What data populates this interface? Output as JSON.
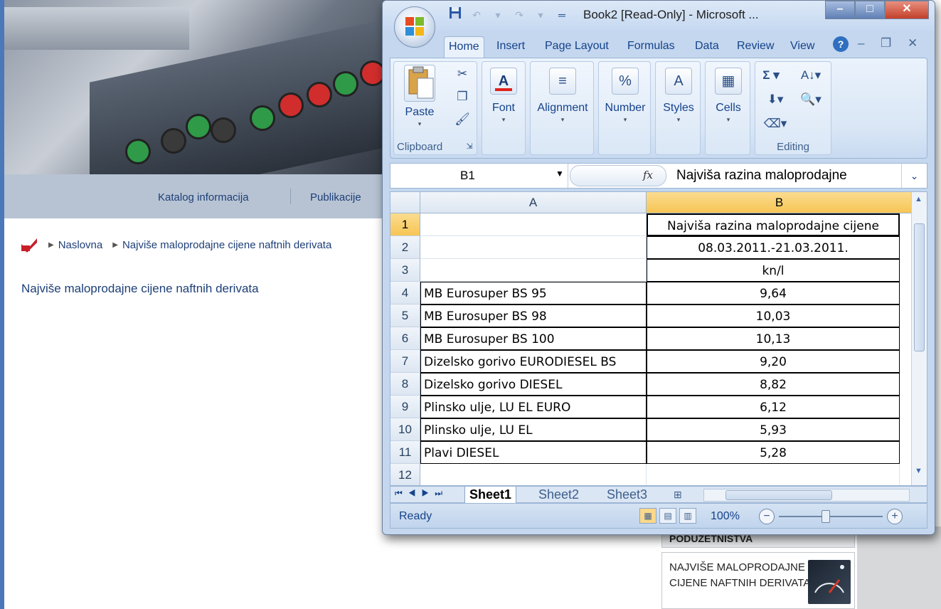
{
  "web": {
    "nav": [
      "Katalog informacija",
      "Publikacije"
    ],
    "breadcrumb": [
      "Naslovna",
      "Najviše maloprodajne cijene naftnih derivata"
    ],
    "heading": "Najviše maloprodajne cijene naftnih derivata",
    "side_box_1": "PODUZETNIŠTVA",
    "side_box_2": "NAJVIŠE MALOPRODAJNE CIJENE NAFTNIH DERIVATA"
  },
  "excel": {
    "title": "Book2  [Read-Only] - Microsoft ...",
    "tabs": [
      "Home",
      "Insert",
      "Page Layout",
      "Formulas",
      "Data",
      "Review",
      "View"
    ],
    "groups": {
      "clipboard": "Clipboard",
      "paste": "Paste",
      "font": "Font",
      "alignment": "Alignment",
      "number": "Number",
      "styles": "Styles",
      "cells": "Cells",
      "editing": "Editing"
    },
    "namebox": "B1",
    "formula": "Najviša razina maloprodajne",
    "columns": [
      "A",
      "B"
    ],
    "rows": [
      {
        "num": "1",
        "a": "",
        "b": "Najviša razina maloprodajne cijene"
      },
      {
        "num": "2",
        "a": "",
        "b": "08.03.2011.-21.03.2011."
      },
      {
        "num": "3",
        "a": "",
        "b": "kn/l"
      },
      {
        "num": "4",
        "a": "MB Eurosuper  BS 95",
        "b": "9,64"
      },
      {
        "num": "5",
        "a": "MB Eurosuper BS 98",
        "b": "10,03"
      },
      {
        "num": "6",
        "a": "MB Eurosuper BS 100",
        "b": "10,13"
      },
      {
        "num": "7",
        "a": "Dizelsko gorivo  EURODIESEL BS",
        "b": "9,20"
      },
      {
        "num": "8",
        "a": "Dizelsko gorivo  DIESEL",
        "b": "8,82"
      },
      {
        "num": "9",
        "a": "Plinsko ulje, LU  EL EURO",
        "b": "6,12"
      },
      {
        "num": "10",
        "a": "Plinsko ulje, LU  EL",
        "b": "5,93"
      },
      {
        "num": "11",
        "a": "Plavi DIESEL",
        "b": "5,28"
      },
      {
        "num": "12",
        "a": "",
        "b": ""
      }
    ],
    "sheets": [
      "Sheet1",
      "Sheet2",
      "Sheet3"
    ],
    "status": "Ready",
    "zoom": "100%"
  }
}
